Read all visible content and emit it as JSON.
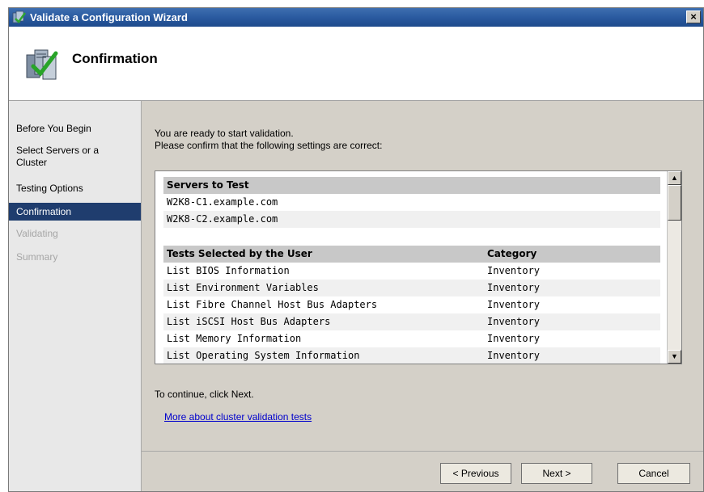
{
  "window": {
    "title": "Validate a Configuration Wizard",
    "close_glyph": "×",
    "title_icon": "wizard-icon"
  },
  "header": {
    "title": "Confirmation",
    "icon": "cluster-validate-icon"
  },
  "sidebar": {
    "steps": [
      {
        "label": "Before You Begin",
        "state": "normal"
      },
      {
        "label": "Select Servers or a Cluster",
        "state": "normal"
      },
      {
        "label": "Testing Options",
        "state": "normal"
      },
      {
        "label": "Confirmation",
        "state": "active"
      },
      {
        "label": "Validating",
        "state": "disabled"
      },
      {
        "label": "Summary",
        "state": "disabled"
      }
    ]
  },
  "main": {
    "intro_line1": "You are ready to start validation.",
    "intro_line2": "Please confirm that the following settings are correct:",
    "servers_header": "Servers to Test",
    "servers": [
      "W2K8-C1.example.com",
      "W2K8-C2.example.com"
    ],
    "tests_header": "Tests Selected by the User",
    "category_header": "Category",
    "tests": [
      {
        "name": "List BIOS Information",
        "category": "Inventory"
      },
      {
        "name": "List Environment Variables",
        "category": "Inventory"
      },
      {
        "name": "List Fibre Channel Host Bus Adapters",
        "category": "Inventory"
      },
      {
        "name": "List iSCSI Host Bus Adapters",
        "category": "Inventory"
      },
      {
        "name": "List Memory Information",
        "category": "Inventory"
      },
      {
        "name": "List Operating System Information",
        "category": "Inventory"
      }
    ],
    "scroll_up": "▲",
    "scroll_down": "▼",
    "continue_text": "To continue, click Next.",
    "link_text": "More about cluster validation tests"
  },
  "buttons": {
    "previous": "< Previous",
    "next": "Next >",
    "cancel": "Cancel"
  },
  "colors": {
    "titlebar": "#2a5aa0",
    "active_step": "#1f3d6e",
    "link": "#0000cc"
  }
}
